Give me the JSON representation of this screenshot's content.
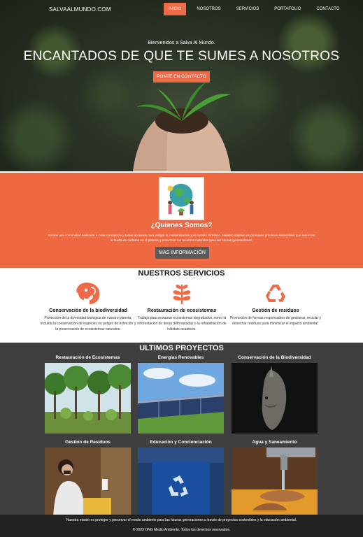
{
  "nav": {
    "brand": "SALVAALMUNDO.COM",
    "items": [
      {
        "label": "INICIO",
        "active": true
      },
      {
        "label": "NOSOTROS",
        "active": false
      },
      {
        "label": "SERVICIOS",
        "active": false
      },
      {
        "label": "PORTAFOLIO",
        "active": false
      },
      {
        "label": "CONTACTO",
        "active": false
      }
    ]
  },
  "hero": {
    "subtitle": "Bienvenidos a Salva Al Mundo.",
    "title": "ENCANTADOS DE QUE TE SUMES A NOSOTROS",
    "button": "PONTE EN CONTACTO"
  },
  "about": {
    "title": "¿Quienes Somos?",
    "text": "Somos una comunidad dedicada a crear conciencia y tomar acciones para mitigar la contaminación y el cambio climático. Nuestro objetivo es promover prácticas sostenibles que reduzcan la huella de carbono en el planeta y preserven los recursos naturales para las futuras generaciones.",
    "button": "MAS INFORMACIÓN"
  },
  "services": {
    "title": "NUESTROS SERVICIOS",
    "items": [
      {
        "icon": "elephant-icon",
        "title": "Conservación de la biodiversidad",
        "text": "Protección de la diversidad biológica de nuestro planeta, incluida la conservación de especies en peligro de extinción y la preservación de ecosistemas naturales."
      },
      {
        "icon": "leaf-icon",
        "title": "Restauración de ecosistemas",
        "text": "Trabajo para restaurar ecosistemas degradados, como la reforestación de áreas deforestadas o la rehabilitación de hábitats acuáticos."
      },
      {
        "icon": "recycle-icon",
        "title": "Gestión de residuos",
        "text": "Promoción de formas responsables de gestionar, reciclar y desechar residuos para minimizar el impacto ambiental."
      }
    ]
  },
  "projects": {
    "title": "ULTIMOS PROYECTOS",
    "items": [
      {
        "title": "Restauración de Ecosistemas"
      },
      {
        "title": "Energías Renovables"
      },
      {
        "title": "Conservación de la Biodiversidad"
      },
      {
        "title": "Gestión de Residuos"
      },
      {
        "title": "Educación y Concienciación"
      },
      {
        "title": "Agua y Saneamiento"
      }
    ]
  },
  "footer": {
    "text": "Nuestra misión es proteger y preservar el medio ambiente para las futuras generaciones a través de proyectos sostenibles y la educación ambiental.",
    "copy": "© 2023 ONG Medio Ambiente. Todos los derechos reservados."
  },
  "colors": {
    "accent": "#ef6a47",
    "about_bg": "#ee6842",
    "projects_bg": "#3f3f3f",
    "footer_bg": "#222222"
  }
}
